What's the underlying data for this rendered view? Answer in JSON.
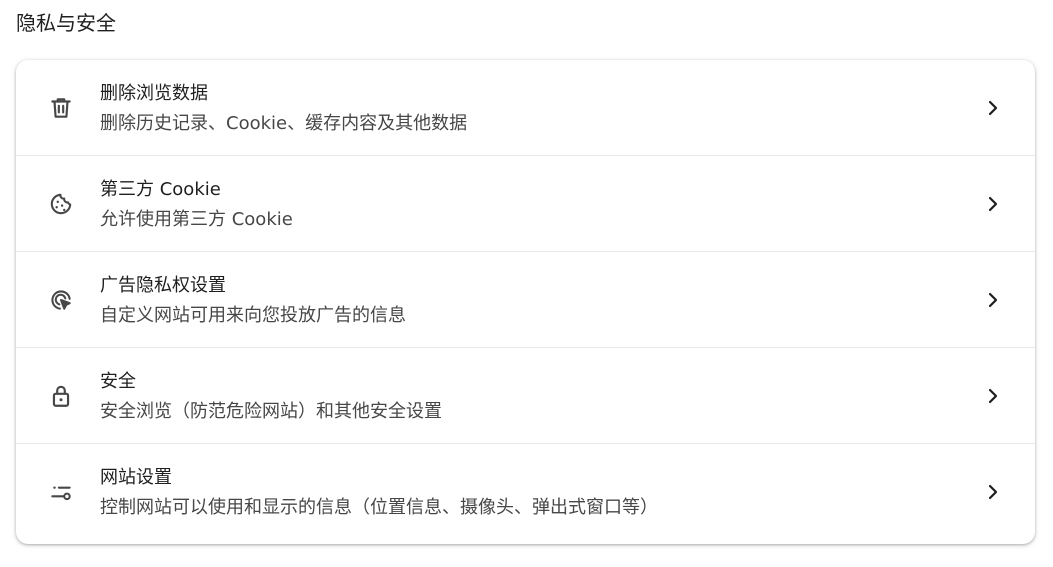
{
  "section": {
    "title": "隐私与安全"
  },
  "items": [
    {
      "title": "删除浏览数据",
      "subtitle": "删除历史记录、Cookie、缓存内容及其他数据",
      "icon": "trash-icon"
    },
    {
      "title": "第三方 Cookie",
      "subtitle": "允许使用第三方 Cookie",
      "icon": "cookie-icon"
    },
    {
      "title": "广告隐私权设置",
      "subtitle": "自定义网站可用来向您投放广告的信息",
      "icon": "ad-privacy-icon"
    },
    {
      "title": "安全",
      "subtitle": "安全浏览（防范危险网站）和其他安全设置",
      "icon": "lock-icon"
    },
    {
      "title": "网站设置",
      "subtitle": "控制网站可以使用和显示的信息（位置信息、摄像头、弹出式窗口等）",
      "icon": "tune-icon"
    }
  ],
  "colors": {
    "icon": "#474747",
    "text_primary": "#1f1f1f",
    "text_secondary": "#474747",
    "divider": "#e8e8e8"
  }
}
